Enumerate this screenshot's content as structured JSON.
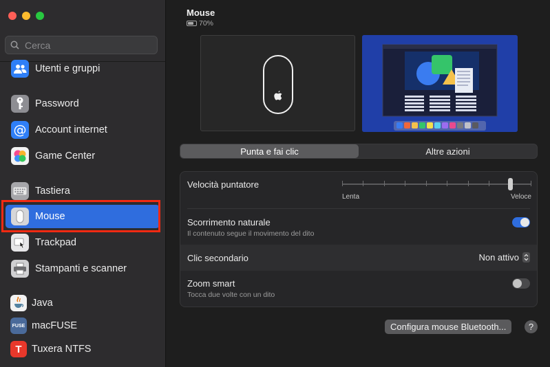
{
  "sidebar": {
    "search_placeholder": "Cerca",
    "items": [
      {
        "label": "Utenti e gruppi",
        "icon": "users-icon"
      },
      {
        "label": "Password",
        "icon": "key-icon"
      },
      {
        "label": "Account internet",
        "icon": "at-icon"
      },
      {
        "label": "Game Center",
        "icon": "game-center-icon"
      },
      {
        "label": "Tastiera",
        "icon": "keyboard-icon"
      },
      {
        "label": "Mouse",
        "icon": "mouse-icon",
        "selected": true
      },
      {
        "label": "Trackpad",
        "icon": "trackpad-icon"
      },
      {
        "label": "Stampanti e scanner",
        "icon": "printer-icon"
      },
      {
        "label": "Java",
        "icon": "java-icon"
      },
      {
        "label": "macFUSE",
        "icon": "macfuse-icon",
        "icon_text": "FUSE"
      },
      {
        "label": "Tuxera NTFS",
        "icon": "tuxera-icon",
        "icon_text": "T"
      }
    ]
  },
  "header": {
    "title": "Mouse",
    "battery": "70%",
    "battery_level": 0.7
  },
  "tabs": [
    {
      "label": "Punta e fai clic",
      "active": true
    },
    {
      "label": "Altre azioni",
      "active": false
    }
  ],
  "settings": {
    "speed": {
      "label": "Velocità puntatore",
      "min_label": "Lenta",
      "max_label": "Veloce",
      "value": 0.9,
      "ticks": 10
    },
    "natural_scroll": {
      "label": "Scorrimento naturale",
      "sub": "Il contenuto segue il movimento del dito",
      "on": true
    },
    "secondary_click": {
      "label": "Clic secondario",
      "value": "Non attivo"
    },
    "smart_zoom": {
      "label": "Zoom smart",
      "sub": "Tocca due volte con un dito",
      "on": false
    }
  },
  "buttons": {
    "bluetooth": "Configura mouse Bluetooth...",
    "help": "?"
  },
  "colors": {
    "accent": "#2f6dde",
    "highlight_outline": "#f32a12"
  }
}
